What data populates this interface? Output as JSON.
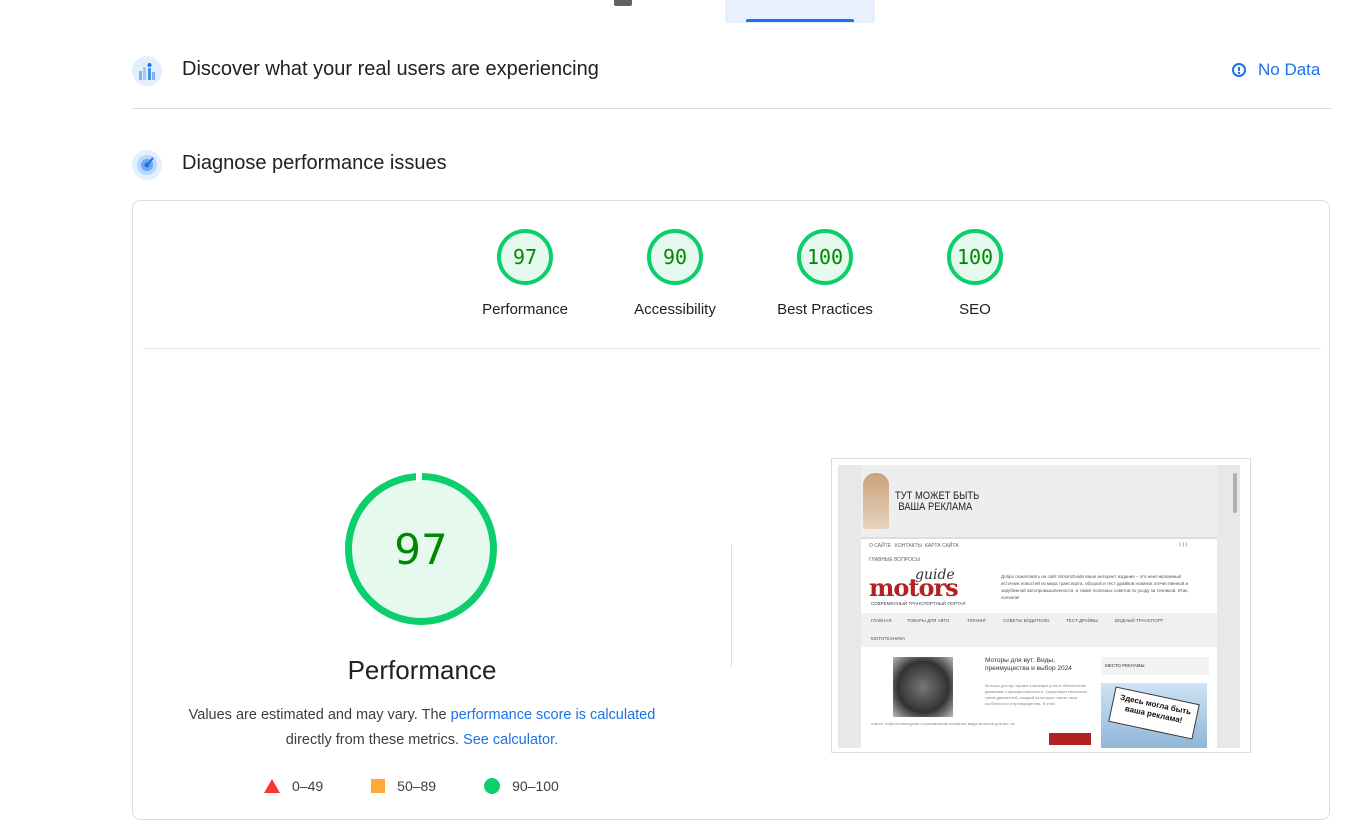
{
  "discover": {
    "title": "Discover what your real users are experiencing",
    "no_data": "No Data"
  },
  "diagnose": {
    "title": "Diagnose performance issues"
  },
  "scores": [
    {
      "value": "97",
      "label": "Performance"
    },
    {
      "value": "90",
      "label": "Accessibility"
    },
    {
      "value": "100",
      "label": "Best Practices"
    },
    {
      "value": "100",
      "label": "SEO"
    }
  ],
  "performance": {
    "score": "97",
    "title": "Performance",
    "desc_part1": "Values are estimated and may vary. The ",
    "desc_link1": "performance score is calculated",
    "desc_part2": " directly from these metrics. ",
    "desc_link2": "See calculator."
  },
  "legend": [
    {
      "range": "0–49"
    },
    {
      "range": "50–89"
    },
    {
      "range": "90–100"
    }
  ],
  "colors": {
    "pass": "#0cce6b",
    "average": "#ffaa33",
    "fail": "#ff3333",
    "link": "#1a73e8"
  },
  "screenshot": {
    "banner_line1": "ТУТ МОЖЕТ БЫТЬ",
    "banner_line2": "ВАША РЕКЛАМА",
    "top_menu": [
      "О САЙТЕ",
      "КОНТАКТЫ",
      "КАРТА САЙТА",
      "ГЛАВНЫЕ ВОПРОСЫ"
    ],
    "logo_guide": "guide",
    "logo_motors": "motors",
    "logo_tagline": "СОВРЕМЕННЫЙ ТРАНСПОРТНЫЙ ПОРТАЛ",
    "site_description": "Добро пожаловать на сайт MotorsGuide ваше интернет издание – это неисчерпаемый источник новостей из мира транспорта, обзоров и тест драйвов новинок отечественной и зарубежной автопромышленности, а также полезных советов по уходу за техникой. Итак, поехали!",
    "main_menu": [
      "ГЛАВНАЯ",
      "ТОВАРЫ ДЛЯ АВТО",
      "ТЮНИНГ",
      "СОВЕТЫ ВОДИТЕЛЮ",
      "ТЕСТ-ДРАЙВЫ",
      "ВОДНЫЙ ТРАНСПОРТ",
      "МОТОТЕХНИКА"
    ],
    "post_title": "Моторы для вут: Виды, преимущества и выбор 2024",
    "post_excerpt": "Моторы для вут играют ключевую роль в обеспечении движения и функциональности. Существует несколько типов двигателей, каждый из которых имеет свои особенности и преимущества. В этой",
    "post_more": "статье: https://motorsguide.ru рассмотрим основные виды моторов для вут, их",
    "ad_title": "МЕСТО РЕКЛАМЫ",
    "billboard_text": "Здесь могла быть ваша реклама!"
  },
  "icons": {
    "discover": "users-field-data-icon",
    "diagnose": "lab-data-icon",
    "info": "info-icon"
  }
}
